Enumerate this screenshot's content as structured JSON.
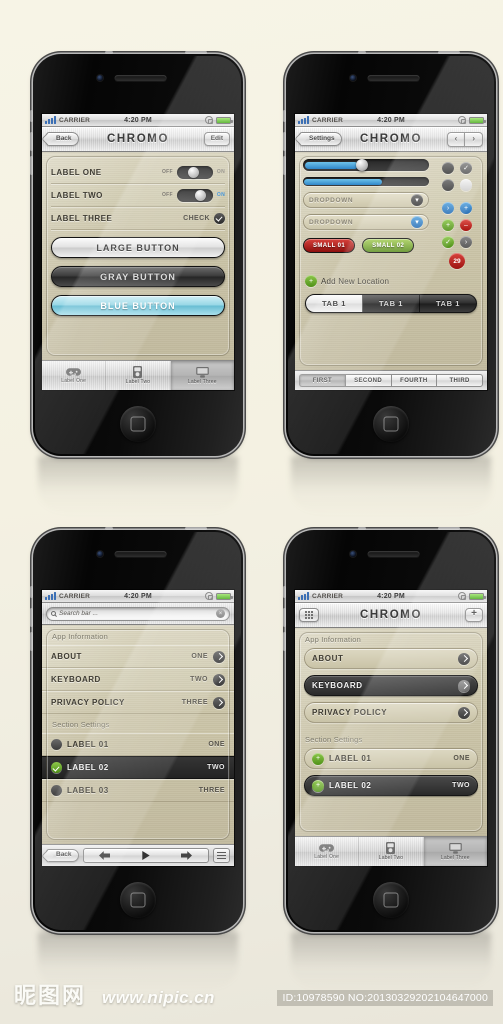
{
  "background_color": "#f4f1e2",
  "accent_colors": {
    "blue": "#2f86c9",
    "green": "#5d8f22",
    "red": "#a8120f",
    "dark": "#2a2a2a",
    "khaki": "#cbc5a9"
  },
  "statusbar": {
    "carrier": "CARRIER",
    "time": "4:20 PM"
  },
  "phone1": {
    "nav": {
      "back": "Back",
      "title": "CHROMO",
      "edit": "Edit"
    },
    "rows": [
      {
        "label": "LABEL ONE",
        "off": "OFF",
        "on": "ON",
        "state": "off"
      },
      {
        "label": "LABEL TWO",
        "off": "OFF",
        "on": "ON",
        "state": "on"
      },
      {
        "label": "LABEL THREE",
        "check_label": "CHECK"
      }
    ],
    "buttons": [
      {
        "label": "LARGE BUTTON",
        "style": "light"
      },
      {
        "label": "GRAY BUTTON",
        "style": "gray"
      },
      {
        "label": "BLUE BUTTON",
        "style": "blue"
      }
    ],
    "tabs": [
      {
        "label": "Label One",
        "icon": "gamepad-icon",
        "active": false
      },
      {
        "label": "Label Two",
        "icon": "ipod-icon",
        "active": false
      },
      {
        "label": "Label Three",
        "icon": "monitor-icon",
        "active": true
      }
    ]
  },
  "phone2": {
    "nav": {
      "back": "Settings",
      "title": "CHROMO",
      "prev": "‹",
      "next": "›"
    },
    "slider": {
      "value": 42
    },
    "progress": {
      "value": 62
    },
    "dropdowns": [
      "DROPDOWN",
      "DROPDOWN"
    ],
    "small_buttons": [
      {
        "label": "SMALL 01",
        "style": "red"
      },
      {
        "label": "SMALL 02",
        "style": "green"
      }
    ],
    "badge": "29",
    "icon_grid": [
      {
        "name": "circle-dark-icon",
        "glyph": "",
        "color": "dark"
      },
      {
        "name": "check-gray-icon",
        "glyph": "✓",
        "color": "gray"
      },
      {
        "name": "circle-dark-icon",
        "glyph": "",
        "color": "dark"
      },
      {
        "name": "circle-white-icon",
        "glyph": "",
        "color": "white"
      },
      {
        "name": "chevron-blue-icon",
        "glyph": "›",
        "color": "blue"
      },
      {
        "name": "plus-blue-icon",
        "glyph": "+",
        "color": "blue"
      },
      {
        "name": "plus-green-icon",
        "glyph": "+",
        "color": "green"
      },
      {
        "name": "minus-red-icon",
        "glyph": "–",
        "color": "red"
      },
      {
        "name": "check-green-icon",
        "glyph": "✓",
        "color": "green"
      },
      {
        "name": "chevron-gray-icon",
        "glyph": "›",
        "color": "gray"
      }
    ],
    "add_row": "Add New Location",
    "tabs": [
      {
        "label": "TAB 1",
        "selected": true
      },
      {
        "label": "TAB 1",
        "selected": false
      },
      {
        "label": "TAB 1",
        "selected": false
      }
    ],
    "bottom_segments": [
      {
        "label": "FIRST",
        "selected": true
      },
      {
        "label": "SECOND",
        "selected": false
      },
      {
        "label": "FOURTH",
        "selected": false
      },
      {
        "label": "THIRD",
        "selected": false
      }
    ]
  },
  "phone3": {
    "search": {
      "placeholder": "Search bar ..."
    },
    "section1_title": "App Information",
    "section1_rows": [
      {
        "label": "ABOUT",
        "value": "ONE"
      },
      {
        "label": "KEYBOARD",
        "value": "TWO"
      },
      {
        "label": "PRIVACY POLICY",
        "value": "THREE"
      }
    ],
    "section2_title": "Section Settings",
    "section2_rows": [
      {
        "label": "LABEL 01",
        "value": "ONE",
        "selected": false
      },
      {
        "label": "LABEL 02",
        "value": "TWO",
        "selected": true
      },
      {
        "label": "LABEL 03",
        "value": "THREE",
        "selected": false
      }
    ],
    "toolbar": {
      "back": "Back",
      "prev_icon": "arrow-left-icon",
      "play_icon": "play-icon",
      "next_icon": "arrow-right-icon",
      "menu_icon": "hamburger-icon"
    }
  },
  "phone4": {
    "nav": {
      "grid": "grid-icon",
      "title": "CHROMO",
      "add": "+"
    },
    "section1_title": "App Information",
    "section1_rows": [
      {
        "label": "ABOUT",
        "selected": false
      },
      {
        "label": "KEYBOARD",
        "selected": true
      },
      {
        "label": "PRIVACY POLICY",
        "selected": false
      }
    ],
    "section2_title": "Section Settings",
    "section2_rows": [
      {
        "label": "LABEL 01",
        "value": "ONE",
        "selected": false
      },
      {
        "label": "LABEL 02",
        "value": "TWO",
        "selected": true
      }
    ],
    "tabs": [
      {
        "label": "Label One",
        "icon": "gamepad-icon",
        "active": false
      },
      {
        "label": "Label Two",
        "icon": "ipod-icon",
        "active": false
      },
      {
        "label": "Label Three",
        "icon": "monitor-icon",
        "active": true
      }
    ]
  },
  "watermark": {
    "site_cn": "昵图网",
    "url": "www.nipic.cn",
    "id_text": "ID:10978590 NO:20130329202104647000"
  }
}
